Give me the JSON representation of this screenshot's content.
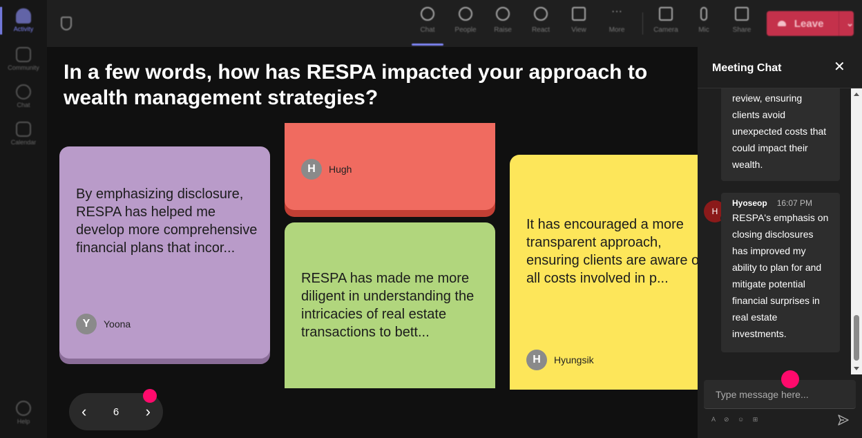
{
  "rail": {
    "items": [
      {
        "label": "Activity",
        "active": true
      },
      {
        "label": "Community"
      },
      {
        "label": "Chat"
      },
      {
        "label": "Calendar"
      }
    ],
    "help": "Help"
  },
  "topbar": {
    "items": [
      "Chat",
      "People",
      "Raise",
      "React",
      "View",
      "More"
    ],
    "media": [
      "Camera",
      "Mic",
      "Share"
    ],
    "leave_label": "Leave"
  },
  "question": "In a few words, how has RESPA impacted your approach to wealth management strategies?",
  "cards": {
    "yoona": {
      "text": "By emphasizing disclosure, RESPA has helped me develop more comprehensive financial plans that incor...",
      "initial": "Y",
      "author": "Yoona",
      "color": "#b99bc9"
    },
    "hugh": {
      "initial": "H",
      "author": "Hugh",
      "color": "#f06b60"
    },
    "green": {
      "text": "RESPA has made me more diligent in understanding the intricacies of real estate transactions to bett...",
      "color": "#b1d67d"
    },
    "hyungsik": {
      "text": "It has encouraged a more transparent approach, ensuring clients are aware of all costs involved in p...",
      "initial": "H",
      "author": "Hyungsik",
      "color": "#fde65a"
    }
  },
  "pager": {
    "page": "6"
  },
  "chat": {
    "title": "Meeting Chat",
    "messages": [
      {
        "text": "review, ensuring clients avoid unexpected costs that could impact their wealth."
      },
      {
        "initial": "H",
        "author": "Hyoseop",
        "time": "16:07 PM",
        "text": "RESPA's emphasis on closing disclosures has improved my ability to plan for and mitigate potential financial surprises in real estate investments."
      }
    ],
    "input_placeholder": "Type message here...",
    "tools": "A ⊘ ☺ ⊞"
  },
  "colors": {
    "accent": "#7f85f5",
    "leave": "#c4314b",
    "indicator": "#ff0a6c"
  }
}
